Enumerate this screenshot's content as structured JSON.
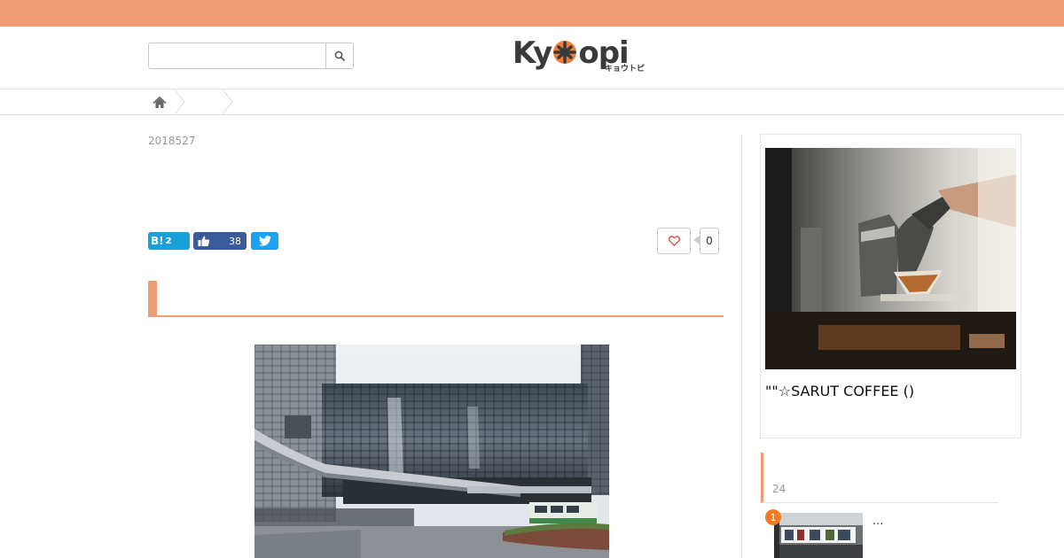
{
  "header": {
    "search": {
      "placeholder": "",
      "value": ""
    },
    "logo": {
      "text_left": "Ky",
      "text_right": "opi",
      "subtitle": "キョウトピ"
    }
  },
  "breadcrumb": {
    "items": [
      "",
      ""
    ]
  },
  "article": {
    "date": "2018527",
    "share": {
      "hatena_label": "B!",
      "hatena_count": "2",
      "facebook_count": "38"
    },
    "like_count": "0"
  },
  "sidebar": {
    "featured_title": "\"\"☆SARUT COFFEE ()",
    "ranking": {
      "count": "24",
      "items": [
        {
          "rank": "1",
          "title": "..."
        }
      ]
    }
  },
  "colors": {
    "accent": "#ef9b74",
    "hatena": "#1aa0d8",
    "facebook": "#3b5a9a",
    "twitter": "#1da1f2",
    "rank_badge": "#f07b22"
  }
}
